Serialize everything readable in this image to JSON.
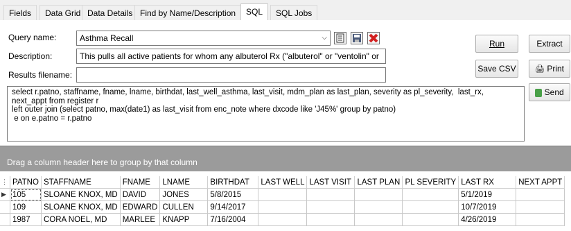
{
  "tabs": [
    {
      "label": "Fields",
      "underline": "F"
    },
    {
      "label": "Data Grid"
    },
    {
      "label": "Data Details"
    },
    {
      "label": "Find by Name/Description"
    },
    {
      "label": "SQL",
      "active": true
    },
    {
      "label": "SQL Jobs"
    }
  ],
  "form": {
    "query_name_label": "Query name:",
    "query_name_value": "Asthma Recall",
    "description_label": "Description:",
    "description_value": "This pulls all active patients for whom any albuterol Rx (\"albuterol\" or \"ventolin\" or",
    "results_label": "Results filename:",
    "results_value": ""
  },
  "buttons": {
    "run": "Run",
    "extract": "Extract",
    "save_csv": "Save CSV",
    "print": "Print",
    "send": "Send"
  },
  "sql_text": "select r.patno, staffname, fname, lname, birthdat, last_well_asthma, last_visit, mdm_plan as last_plan, severity as pl_severity,  last_rx,\nnext_appt from register r\nleft outer join (select patno, max(date1) as last_visit from enc_note where dxcode like 'J45%' group by patno)\n e on e.patno = r.patno",
  "grid": {
    "group_hint": "Drag a column header here to group by that column",
    "columns": [
      "PATNO",
      "STAFFNAME",
      "FNAME",
      "LNAME",
      "BIRTHDAT",
      "LAST WELL",
      "LAST VISIT",
      "LAST PLAN",
      "PL SEVERITY",
      "LAST RX",
      "NEXT APPT"
    ],
    "rows": [
      [
        "105",
        "SLOANE KNOX, MD",
        "DAVID",
        "JONES",
        "5/8/2015",
        "",
        "",
        "",
        "",
        "5/1/2019",
        ""
      ],
      [
        "109",
        "SLOANE KNOX, MD",
        "EDWARD",
        "CULLEN",
        "9/14/2017",
        "",
        "",
        "",
        "",
        "10/7/2019",
        ""
      ],
      [
        "1987",
        "CORA NOEL, MD",
        "MARLEE",
        "KNAPP",
        "7/16/2004",
        "",
        "",
        "",
        "",
        "4/26/2019",
        ""
      ]
    ]
  }
}
